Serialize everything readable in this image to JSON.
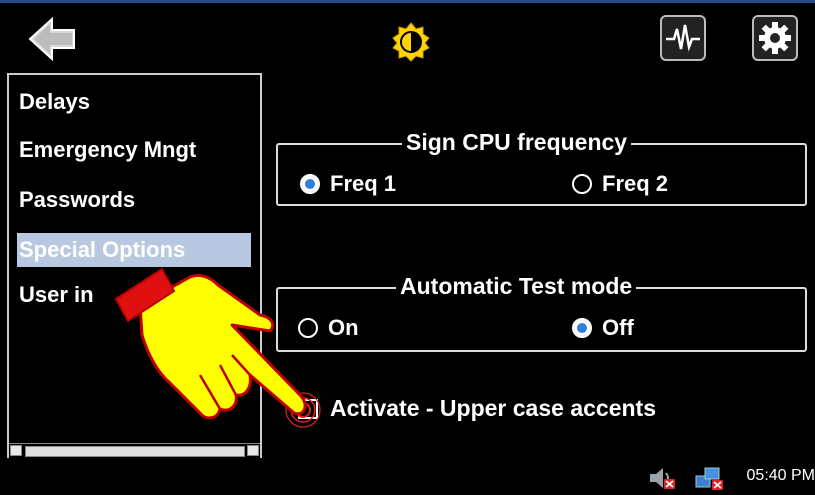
{
  "header": {
    "back_icon": "back-arrow-icon",
    "brightness_icon": "brightness-icon",
    "diagnostics_icon": "waveform-icon",
    "settings_icon": "gear-icon"
  },
  "sidebar": {
    "items": [
      {
        "label": "Delays"
      },
      {
        "label": "Emergency Mngt"
      },
      {
        "label": "Passwords"
      },
      {
        "label": "Special Options",
        "selected": true
      },
      {
        "label": "User in"
      }
    ]
  },
  "cpu_frequency": {
    "title": "Sign CPU frequency",
    "options": [
      {
        "label": "Freq 1",
        "selected": true
      },
      {
        "label": "Freq 2",
        "selected": false
      }
    ]
  },
  "auto_test": {
    "title": "Automatic Test mode",
    "options": [
      {
        "label": "On",
        "selected": false
      },
      {
        "label": "Off",
        "selected": true
      }
    ]
  },
  "accents": {
    "label": "Activate - Upper case accents",
    "checked": false
  },
  "taskbar": {
    "time": "05:40 PM",
    "tray_icons": [
      "speaker-muted-icon",
      "network-disconnected-icon"
    ]
  },
  "colors": {
    "selection": "#b8c8e0",
    "radio_on": "#2e7fe0",
    "hand": "#ffff00"
  }
}
